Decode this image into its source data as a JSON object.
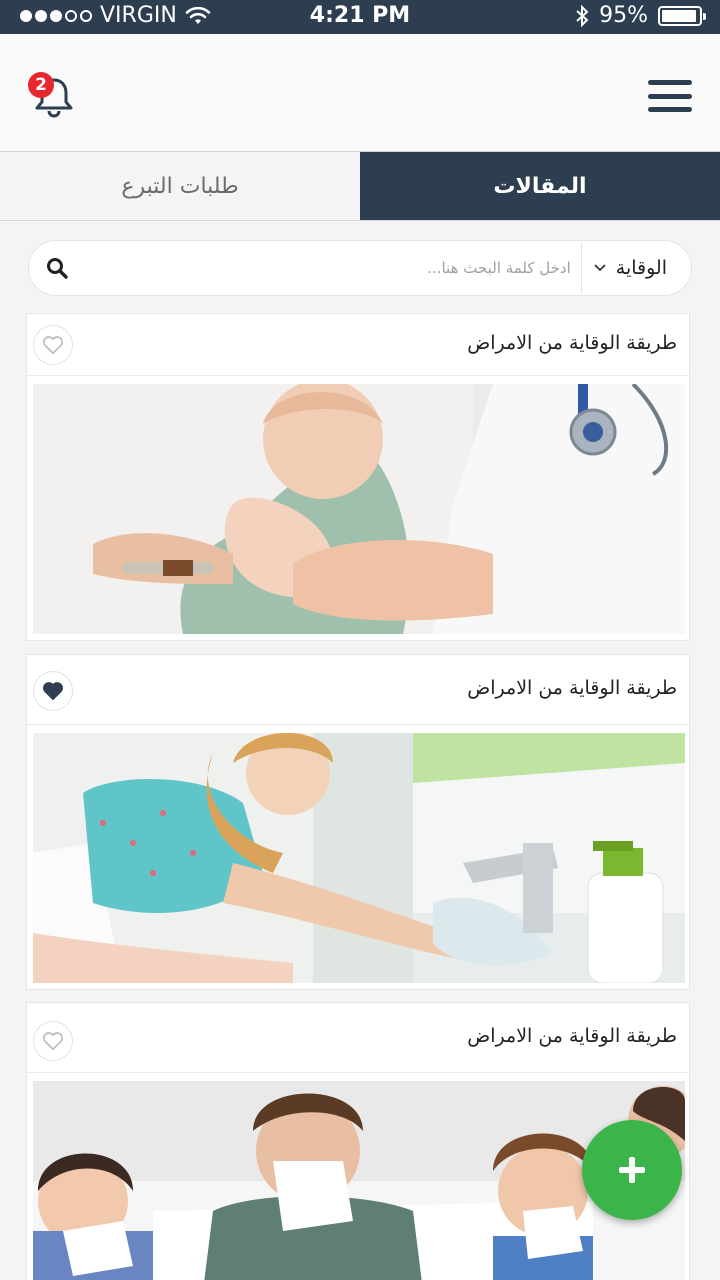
{
  "status_bar": {
    "carrier": "VIRGIN",
    "time": "4:21 PM",
    "battery": "95%",
    "battery_level": 0.95,
    "signal_dots_filled": 3,
    "signal_dots_total": 5
  },
  "header": {
    "notification_count": "2",
    "icons": {
      "left": "bell-icon",
      "right": "menu-icon"
    },
    "colors": {
      "primary": "#2d3e50",
      "badge": "#e8262d"
    }
  },
  "tabs": [
    {
      "label": "المقالات",
      "active": true
    },
    {
      "label": "طلبات التبرع",
      "active": false
    }
  ],
  "search": {
    "placeholder": "ادخل كلمة البحث هنا...",
    "category": "الوقاية"
  },
  "articles": [
    {
      "title": "طريقة الوقاية من الامراض",
      "favorited": false
    },
    {
      "title": "طريقة الوقاية من الامراض",
      "favorited": true
    },
    {
      "title": "طريقة الوقاية من الامراض",
      "favorited": false
    }
  ],
  "fab": {
    "icon": "plus-icon",
    "color": "#3bb54a"
  }
}
